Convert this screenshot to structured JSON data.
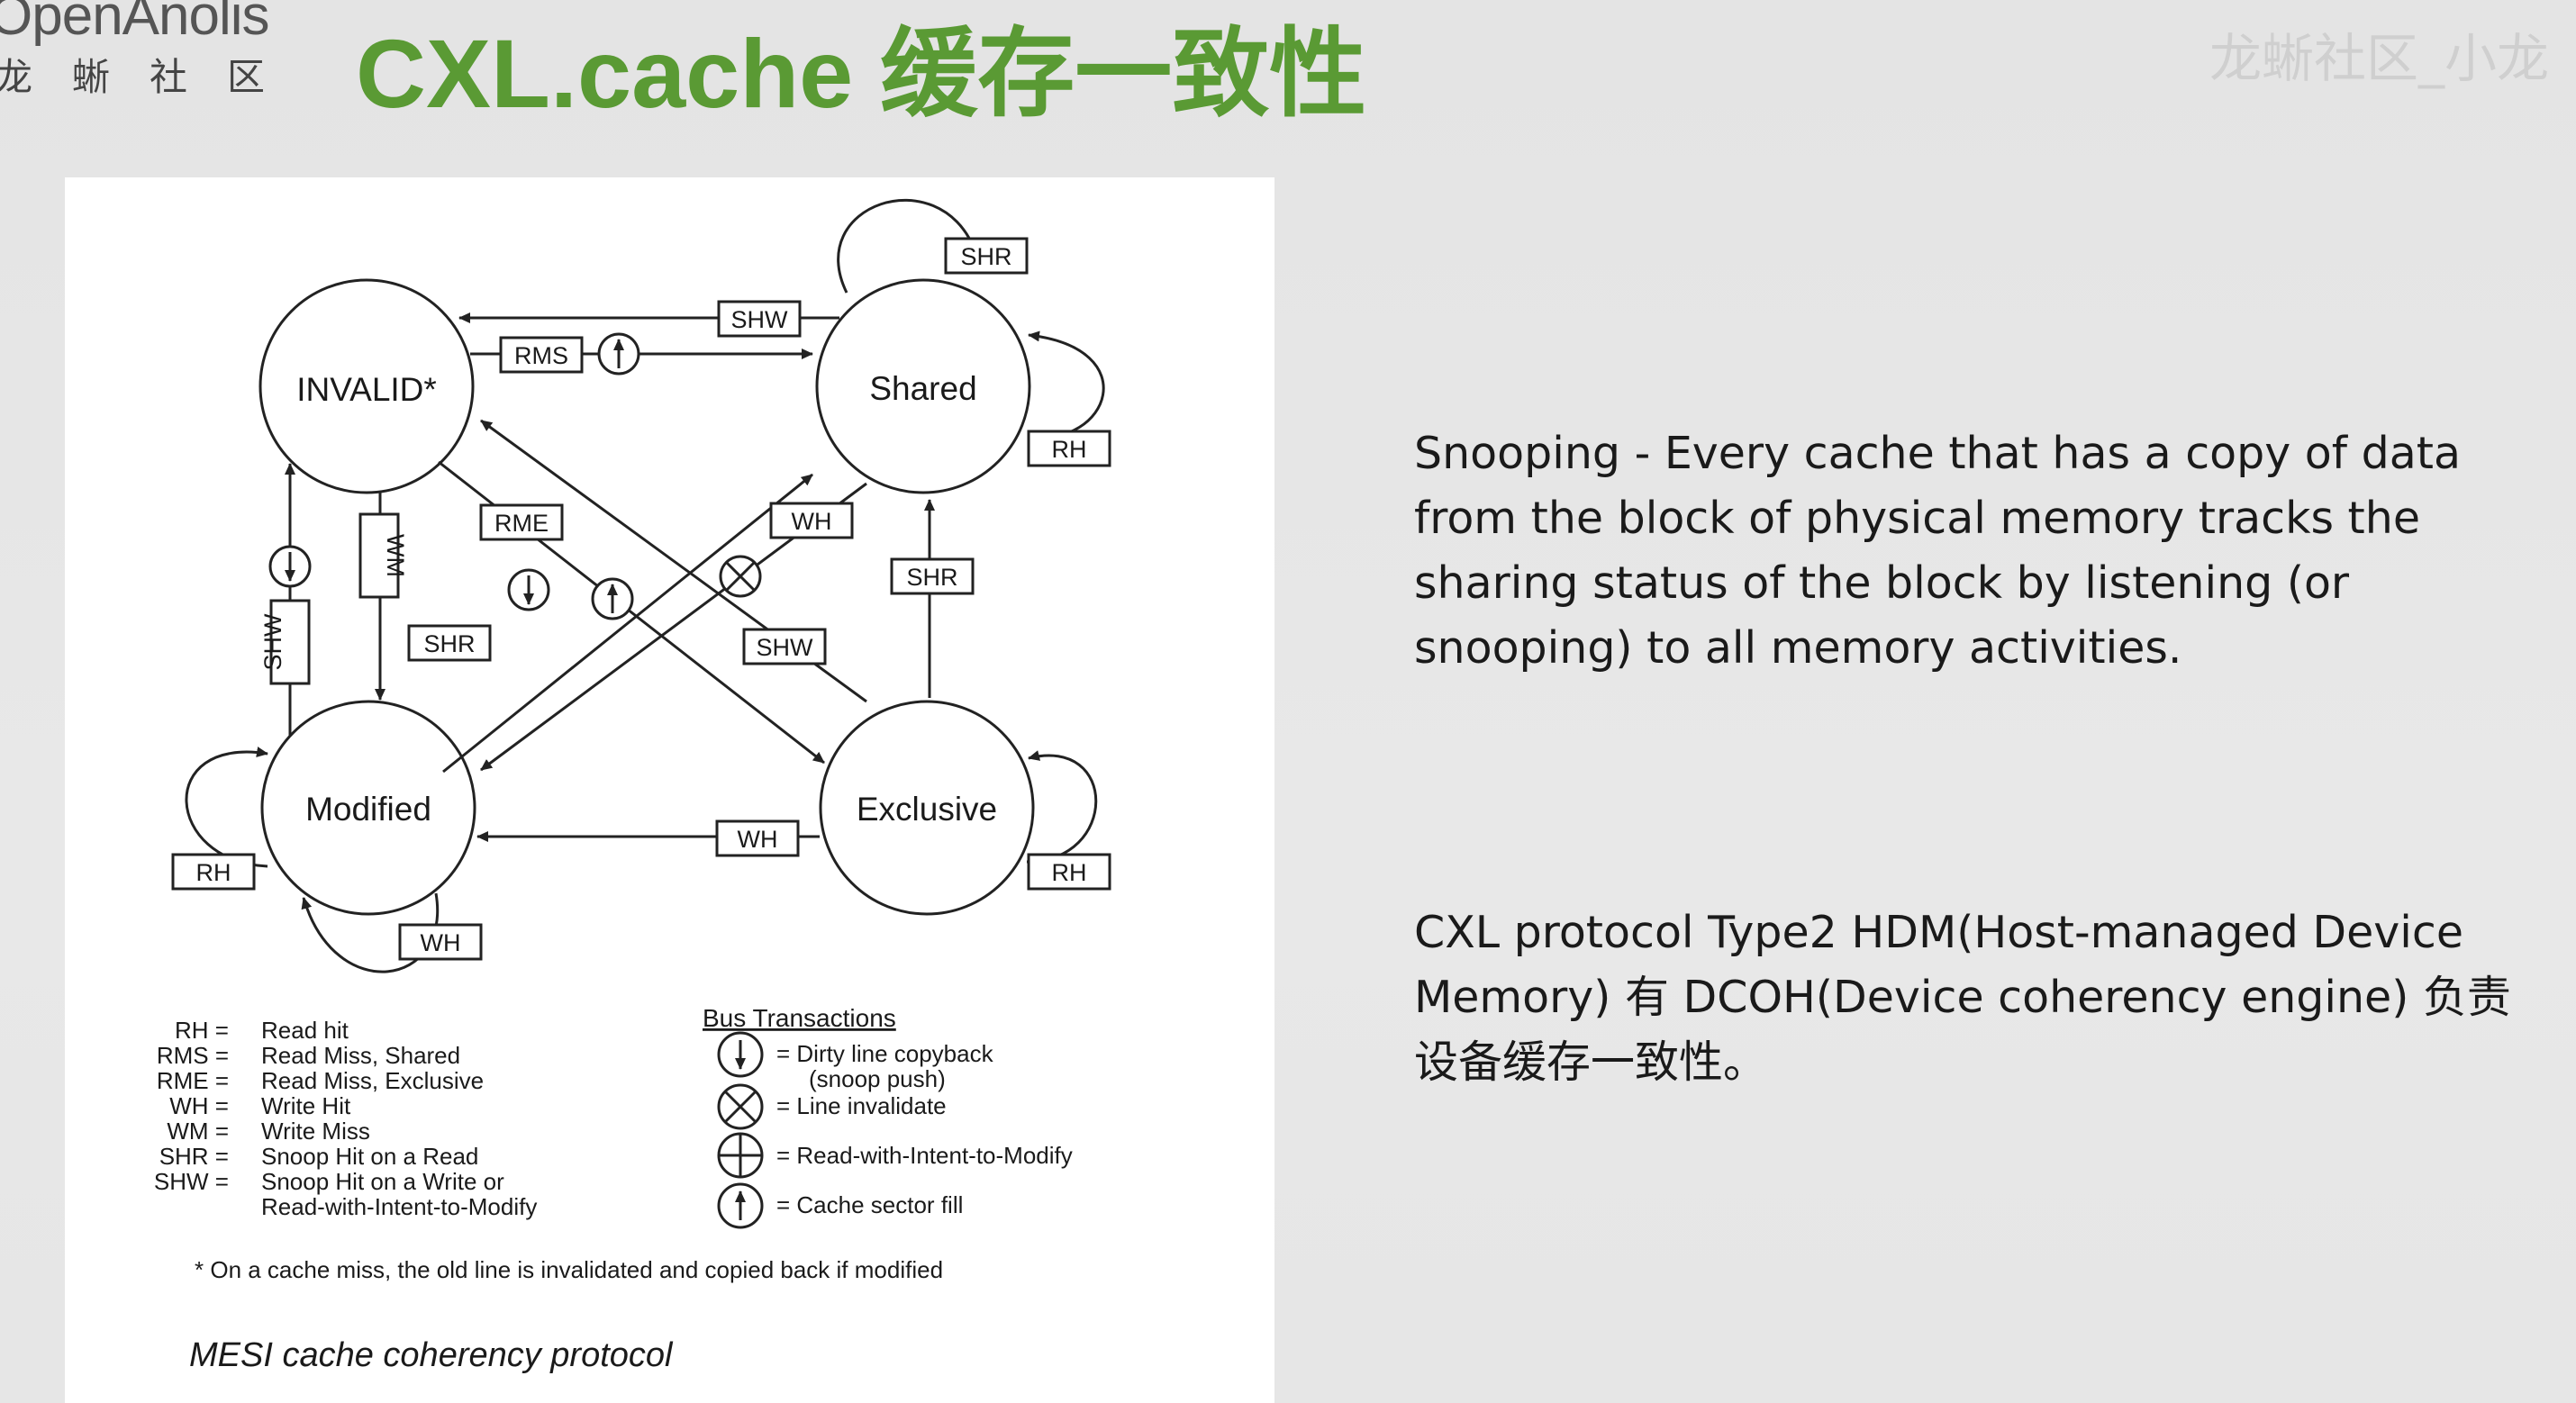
{
  "header": {
    "logo_en": "OpenAnolis",
    "logo_cn": "龙蜥社区",
    "title": "CXL.cache 缓存一致性",
    "watermark": "龙蜥社区_小龙"
  },
  "diagram": {
    "states": {
      "invalid": "INVALID*",
      "shared": "Shared",
      "modified": "Modified",
      "exclusive": "Exclusive"
    },
    "edge_labels": {
      "shw_top": "SHW",
      "rms": "RMS",
      "shr_shared_self": "SHR",
      "rh_shared_self": "RH",
      "rme": "RME",
      "wm": "WM",
      "wh_shared_modified": "WH",
      "shr_exclusive_shared": "SHR",
      "shw_left": "SHW",
      "shr_modified_shared": "SHR",
      "shw_exclusive_invalid": "SHW",
      "wh_exclusive_modified": "WH",
      "rh_modified_self": "RH",
      "wh_modified_self": "WH",
      "rh_exclusive_self": "RH"
    },
    "legend_abbrev": [
      {
        "abbr": "RH =",
        "text": "Read hit"
      },
      {
        "abbr": "RMS =",
        "text": "Read Miss, Shared"
      },
      {
        "abbr": "RME =",
        "text": "Read Miss, Exclusive"
      },
      {
        "abbr": "WH =",
        "text": "Write Hit"
      },
      {
        "abbr": "WM =",
        "text": "Write Miss"
      },
      {
        "abbr": "SHR =",
        "text": "Snoop Hit on a Read"
      },
      {
        "abbr": "SHW =",
        "text": "Snoop Hit on a Write or"
      },
      {
        "abbr": "",
        "text": "Read-with-Intent-to-Modify"
      }
    ],
    "bus_title": "Bus Transactions",
    "bus_items": [
      {
        "symbol": "down-arrow-circle",
        "text": "=  Dirty line copyback"
      },
      {
        "symbol": "",
        "text": "(snoop push)"
      },
      {
        "symbol": "x-circle",
        "text": "=  Line invalidate"
      },
      {
        "symbol": "plus-circle",
        "text": "=  Read-with-Intent-to-Modify"
      },
      {
        "symbol": "up-arrow-circle",
        "text": "=  Cache sector fill"
      }
    ],
    "footnote": "* On a cache miss, the old line is invalidated and copied back if modified",
    "caption": "MESI cache coherency protocol"
  },
  "text_blocks": {
    "snooping": "Snooping - Every cache that has a copy of data from the block of physical memory tracks the sharing status of the block by listening (or snooping) to all memory activities.",
    "cxl": "CXL protocol Type2 HDM(Host-managed Device Memory) 有 DCOH(Device coherency engine) 负责设备缓存一致性。"
  }
}
